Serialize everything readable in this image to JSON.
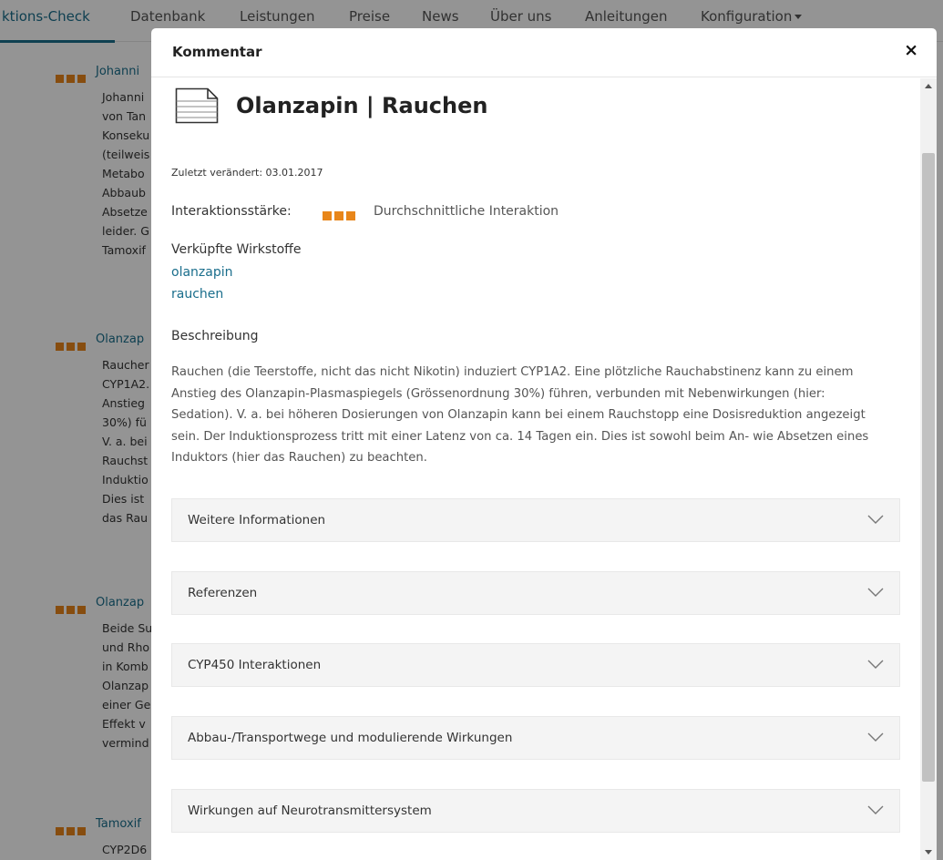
{
  "nav": {
    "items": [
      "ktions-Check",
      "Datenbank",
      "Leistungen",
      "Preise",
      "News",
      "Über uns",
      "Anleitungen",
      "Konfiguration"
    ]
  },
  "background_list": [
    {
      "title": "Johanni",
      "lines": [
        "Johanni",
        "von Tan",
        "Konseku",
        "(teilweis",
        "Metabo",
        "Abbaub",
        "Absetze",
        "leider. G",
        "Tamoxif"
      ]
    },
    {
      "title": "Olanzap",
      "lines": [
        "Raucher",
        "CYP1A2.",
        "Anstieg",
        "30%) fü",
        "V. a. bei",
        "Rauchst",
        "Induktio",
        "Dies ist",
        "das Rau"
      ]
    },
    {
      "title": "Olanzap",
      "lines": [
        "Beide Su",
        "und Rho",
        "in Komb",
        "Olanzap",
        "einer Ge",
        "Effekt v",
        "vermind"
      ]
    },
    {
      "title": "Tamoxif",
      "lines": [
        "CYP2D6"
      ]
    }
  ],
  "modal": {
    "title": "Kommentar",
    "close_glyph": "×",
    "heading": "Olanzapin | Rauchen",
    "last_changed": "Zuletzt verändert: 03.01.2017",
    "strength_label": "Interaktionsstärke:",
    "strength_text": "Durchschnittliche Interaktion",
    "strength_color": "#e8861a",
    "linked_label": "Verküpfte Wirkstoffe",
    "linked": [
      "olanzapin",
      "rauchen"
    ],
    "description_label": "Beschreibung",
    "description_lines": [
      "Rauchen (die Teerstoffe, nicht das nicht Nikotin) induziert CYP1A2. Eine plötzliche Rauchabstinenz kann zu einem",
      "Anstieg des Olanzapin-Plasmaspiegels (Grössenordnung 30%) führen, verbunden mit Nebenwirkungen (hier:",
      "Sedation). V. a. bei höheren Dosierungen von Olanzapin kann bei einem Rauchstopp eine Dosisreduktion angezeigt",
      "sein. Der Induktionsprozess tritt mit einer Latenz von ca. 14 Tagen ein. Dies ist sowohl beim An- wie Absetzen eines",
      "Induktors (hier das Rauchen) zu beachten."
    ],
    "accordions": [
      "Weitere Informationen",
      "Referenzen",
      "CYP450 Interaktionen",
      "Abbau-/Transportwege und modulierende Wirkungen",
      "Wirkungen auf Neurotransmittersystem"
    ]
  },
  "colors": {
    "link": "#1a6e8c",
    "severity": "#e8861a"
  }
}
